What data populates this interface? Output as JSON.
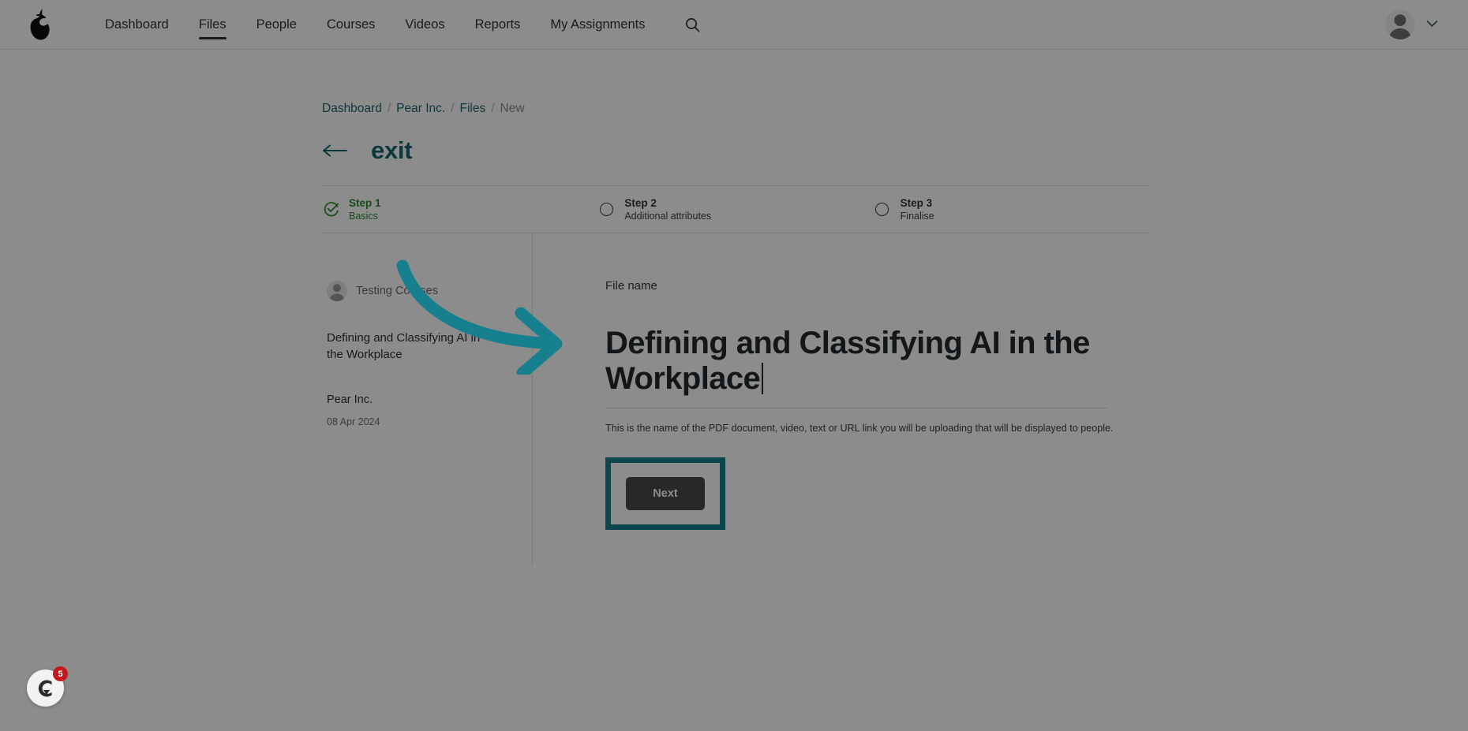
{
  "topnav": {
    "logo_icon": "pear-logo-icon",
    "links": [
      {
        "label": "Dashboard",
        "active": false
      },
      {
        "label": "Files",
        "active": true
      },
      {
        "label": "People",
        "active": false
      },
      {
        "label": "Courses",
        "active": false
      },
      {
        "label": "Videos",
        "active": false
      },
      {
        "label": "Reports",
        "active": false
      },
      {
        "label": "My Assignments",
        "active": false
      }
    ],
    "search_icon": "search-icon",
    "avatar_icon": "user-avatar-icon",
    "chevron_icon": "chevron-down-icon"
  },
  "breadcrumb": {
    "items": [
      "Dashboard",
      "Pear Inc.",
      "Files",
      "New"
    ],
    "separator": "/"
  },
  "header": {
    "back_arrow": "←",
    "exit_label": "exit"
  },
  "stepper": {
    "steps": [
      {
        "title": "Step 1",
        "subtitle": "Basics",
        "state": "done"
      },
      {
        "title": "Step 2",
        "subtitle": "Additional attributes",
        "state": "pending"
      },
      {
        "title": "Step 3",
        "subtitle": "Finalise",
        "state": "pending"
      }
    ]
  },
  "sidebar": {
    "owner": "Testing Courses",
    "doc_title": "Defining and Classifying AI in the Workplace",
    "org": "Pear Inc.",
    "date": "08 Apr 2024"
  },
  "form": {
    "field_label": "File name",
    "file_name_value": "Defining and Classifying AI in the Workplace",
    "file_name_placeholder": "File name",
    "helper_text": "This is the name of the PDF document, video, text or URL link you will be uploading that will be displayed to people.",
    "next_label": "Next"
  },
  "widget": {
    "icon": "chat-widget-icon",
    "badge_count": "5"
  },
  "colors": {
    "teal_accent": "#17808f",
    "teal_link": "#1c656f",
    "green_step": "#2e8b31",
    "button_dark": "#4a4a4a",
    "badge_red": "#c4161c"
  }
}
